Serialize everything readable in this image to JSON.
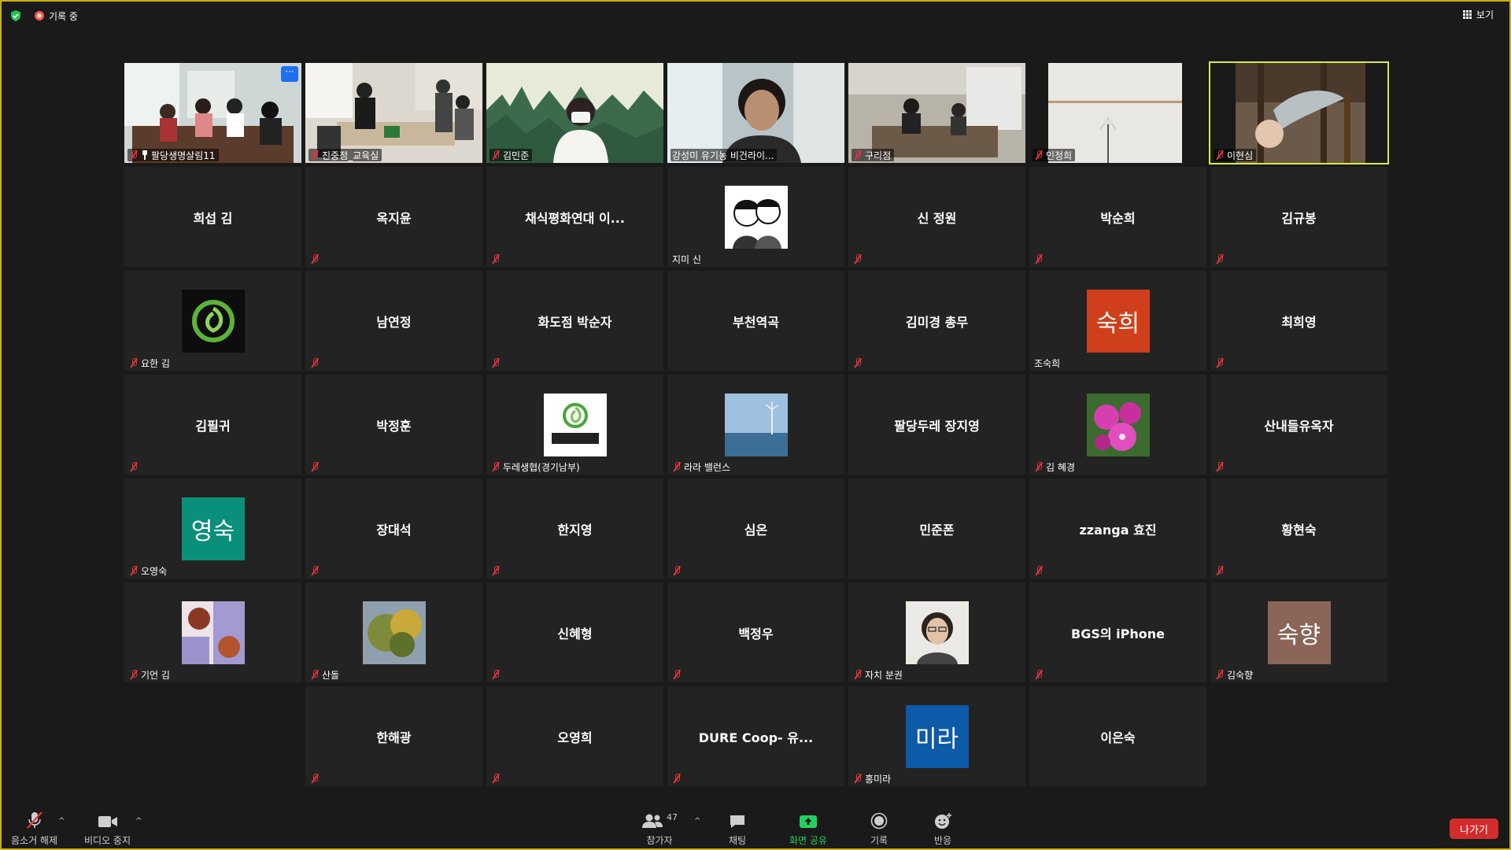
{
  "top": {
    "recording_label": "기록 중",
    "view_label": "보기"
  },
  "colors": {
    "active_speaker_border": "#d5ec3f",
    "window_border": "#c9b300",
    "leave_button": "#d22c2c",
    "share_green": "#23d160"
  },
  "participants": [
    {
      "name": "팔당생명살림11",
      "video": true,
      "muted": true,
      "pinned": true
    },
    {
      "name": "진중점_교육실",
      "video": true,
      "muted": true
    },
    {
      "name": "김민준",
      "video": true,
      "muted": true
    },
    {
      "name": "강성미 유기농 비건라이...",
      "video": true,
      "muted": false
    },
    {
      "name": "구리점",
      "video": true,
      "muted": true
    },
    {
      "name": "인정희",
      "video": true,
      "muted": true
    },
    {
      "name": "이현심",
      "video": true,
      "muted": true,
      "active": true
    },
    {
      "name": "희섭 김",
      "muted": false
    },
    {
      "name": "옥지윤",
      "muted": true
    },
    {
      "name": "채식평화연대 이...",
      "muted": true
    },
    {
      "name": "지미 신",
      "muted": false,
      "avatar": "photo-sketch"
    },
    {
      "name": "신 정원",
      "muted": true
    },
    {
      "name": "박순희",
      "muted": true
    },
    {
      "name": "김규봉",
      "muted": true
    },
    {
      "name": "요한 김",
      "muted": true,
      "avatar": "photo-logo"
    },
    {
      "name": "남연정",
      "muted": true
    },
    {
      "name": "화도점 박순자",
      "muted": true
    },
    {
      "name": "부천역곡",
      "muted": false
    },
    {
      "name": "김미경 총무",
      "muted": true
    },
    {
      "name": "조숙희",
      "muted": false,
      "avatar": "text",
      "avatar_text": "숙희",
      "avatar_color": "#cf3f1c"
    },
    {
      "name": "최희영",
      "muted": true
    },
    {
      "name": "김필귀",
      "muted": true
    },
    {
      "name": "박정훈",
      "muted": true
    },
    {
      "name": "두레생협(경기남부)",
      "muted": true,
      "avatar": "photo-dure"
    },
    {
      "name": "라라 밸런스",
      "muted": true,
      "avatar": "photo-sea"
    },
    {
      "name": "팔당두레 장지영",
      "muted": false
    },
    {
      "name": "김 혜경",
      "muted": true,
      "avatar": "photo-flower"
    },
    {
      "name": "산내들유옥자",
      "muted": true
    },
    {
      "name": "오영숙",
      "muted": true,
      "avatar": "text",
      "avatar_text": "영숙",
      "avatar_color": "#0a8f7a"
    },
    {
      "name": "장대석",
      "muted": true
    },
    {
      "name": "한지영",
      "muted": true
    },
    {
      "name": "심온",
      "muted": true
    },
    {
      "name": "민준폰",
      "muted": false
    },
    {
      "name": "zzanga 효진",
      "muted": true
    },
    {
      "name": "황현숙",
      "muted": true
    },
    {
      "name": "기언 김",
      "muted": true,
      "avatar": "photo-dog"
    },
    {
      "name": "산돌",
      "muted": true,
      "avatar": "photo-tree"
    },
    {
      "name": "신혜형",
      "muted": true
    },
    {
      "name": "백정우",
      "muted": true
    },
    {
      "name": "자치 분권",
      "muted": true,
      "avatar": "photo-woman"
    },
    {
      "name": "BGS의 iPhone",
      "muted": true
    },
    {
      "name": "김숙향",
      "muted": true,
      "avatar": "text",
      "avatar_text": "숙향",
      "avatar_color": "#8b6658"
    },
    {
      "name": "한해광",
      "muted": true
    },
    {
      "name": "오영희",
      "muted": true
    },
    {
      "name": "DURE Coop- 유...",
      "muted": true
    },
    {
      "name": "홍미라",
      "muted": true,
      "avatar": "text",
      "avatar_text": "미라",
      "avatar_color": "#0c5aa8"
    },
    {
      "name": "이은숙",
      "muted": false
    }
  ],
  "toolbar": {
    "unmute": "음소거 해제",
    "stop_video": "비디오 중지",
    "participants": "참가자",
    "participants_count": "47",
    "chat": "채팅",
    "share": "화면 공유",
    "record": "기록",
    "reactions": "반응",
    "leave": "나가기"
  }
}
